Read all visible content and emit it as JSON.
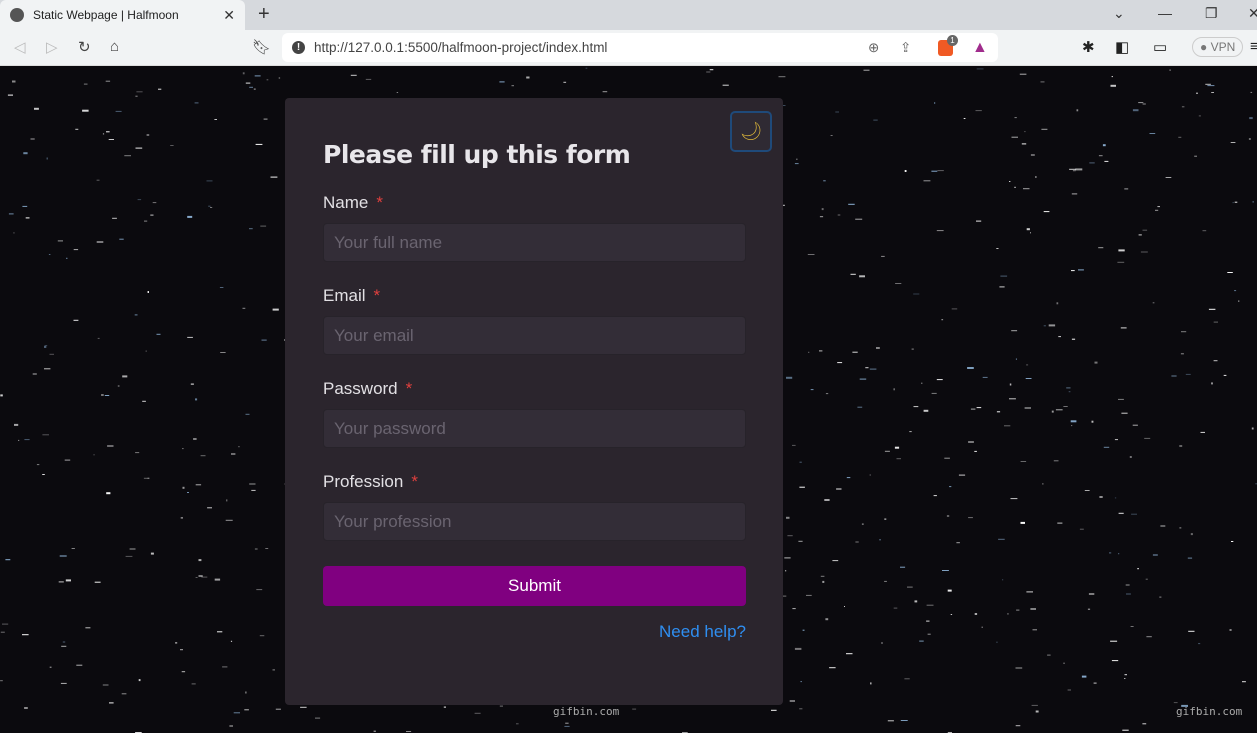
{
  "browser": {
    "tab_title": "Static Webpage | Halfmoon",
    "url": "http://127.0.0.1:5500/halfmoon-project/index.html",
    "vpn_label": "VPN",
    "brave_badge": "1"
  },
  "form": {
    "title": "Please fill up this form",
    "required_mark": "*",
    "fields": [
      {
        "label": "Name",
        "placeholder": "Your full name"
      },
      {
        "label": "Email",
        "placeholder": "Your email"
      },
      {
        "label": "Password",
        "placeholder": "Your password"
      },
      {
        "label": "Profession",
        "placeholder": "Your profession"
      }
    ],
    "submit_label": "Submit",
    "help_link": "Need help?",
    "theme_toggle_icon": "moon-icon"
  },
  "watermark": "gifbin.com",
  "colors": {
    "submit": "#800080",
    "link": "#2f8ef0",
    "required": "#e0403e",
    "card": "#2b252d"
  }
}
